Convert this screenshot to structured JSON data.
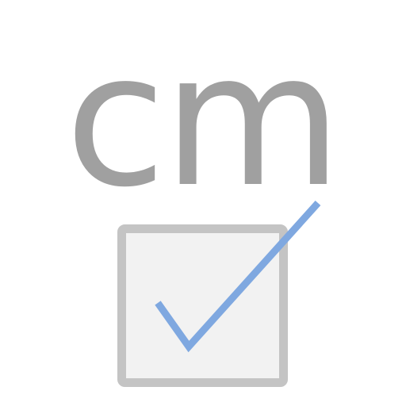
{
  "label": {
    "text": "cm"
  },
  "checkbox": {
    "checked": true,
    "icon": "checkmark-icon"
  },
  "colors": {
    "text": "#a0a0a0",
    "box_border": "#c4c4c4",
    "box_fill": "#f2f2f2",
    "check": "#7fa8e0"
  }
}
